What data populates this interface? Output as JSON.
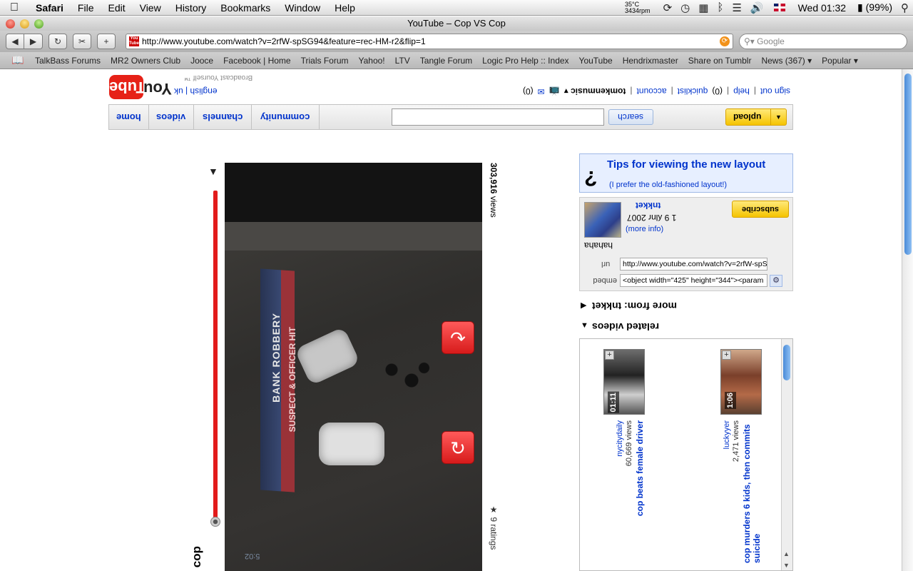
{
  "menubar": {
    "apple": "",
    "app": "Safari",
    "items": [
      "File",
      "Edit",
      "View",
      "History",
      "Bookmarks",
      "Window",
      "Help"
    ],
    "temperature": "35°C",
    "rpm": "3434rpm",
    "clock": "Wed 01:32",
    "battery": "(99%)"
  },
  "window": {
    "title": "YouTube – Cop VS Cop",
    "url": "http://www.youtube.com/watch?v=2rfW-spSG94&feature=rec-HM-r2&flip=1",
    "search_placeholder": "Google"
  },
  "bookmarks": [
    "TalkBass Forums",
    "MR2 Owners Club",
    "Jooce",
    "Facebook | Home",
    "Trials Forum",
    "Yahoo!",
    "LTV",
    "Tangle Forum",
    "Logic Pro Help :: Index",
    "YouTube",
    "Hendrixmaster",
    "Share on Tumblr",
    "News (367) ▾",
    "Popular ▾"
  ],
  "yt": {
    "logo_you": "You",
    "logo_tube": "Tube",
    "broadcast": "Broadcast Yourself ™",
    "lang": "english | uk",
    "links": {
      "signout": "sign out",
      "help": "help",
      "quicklist": "quicklist",
      "quicklist_count": "(0)",
      "account": "account",
      "username": "tomkenmusic",
      "inbox_count": "(0)"
    },
    "nav": {
      "home": "home",
      "videos": "videos",
      "channels": "channels",
      "community": "community"
    },
    "search_label": "search",
    "upload_label": "upload"
  },
  "video": {
    "title": "cop",
    "views_number": "303,916",
    "views_label": "views",
    "ratings": "9 ratings",
    "banner_line1": "BANK ROBBERY",
    "banner_line2": "SUSPECT & OFFICER HIT",
    "timestamp_overlay": "5:02"
  },
  "sidebar": {
    "tips_title": "Tips for viewing the new layout",
    "tips_sub": "(I prefer the old-fashioned layout!)",
    "tips_icon": "?",
    "uploader": "tnkket",
    "upload_date": "1 9 ʎlnɾ 2007",
    "more_info": "(more info)",
    "description": "hahaha",
    "subscribe": "subscribe",
    "url_label": "url",
    "url_value": "http://www.youtube.com/watch?v=2rfW-spS",
    "embed_label": "embed",
    "embed_value": "<object width=\"425\" height=\"344\"><param",
    "more_from": "more from: tnkket",
    "related_head": "related videos"
  },
  "related": [
    {
      "title": "cop beats female driver",
      "meta": "60,669 views",
      "user": "nycitydaily",
      "duration": "01:11"
    },
    {
      "title": "cop murders 6 kids, then commits suicide",
      "meta": "2,471 views",
      "user": "luckyyer",
      "duration": "1:06"
    }
  ],
  "colors": {
    "yt_red": "#e62117",
    "link_blue": "#0033cc",
    "upload_yellow": "#f5c400"
  }
}
